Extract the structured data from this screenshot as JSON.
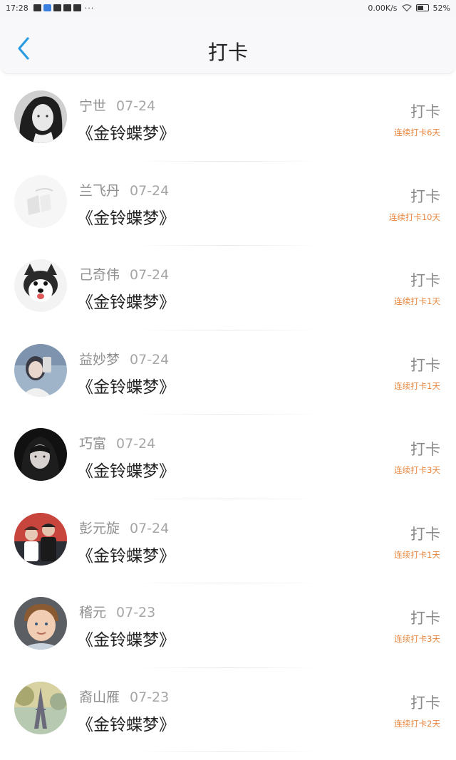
{
  "status_bar": {
    "time": "17:28",
    "more": "···",
    "speed": "0.00K/s",
    "battery": "52%"
  },
  "header": {
    "title": "打卡",
    "back_icon": "chevron-left-icon",
    "accent_color": "#2a9be0"
  },
  "entries": [
    {
      "name": "宁世",
      "date": "07-24",
      "book": "《金铃蝶梦》",
      "action": "打卡",
      "streak": "连续打卡6天",
      "avatar": "woman-dark-hair-bw"
    },
    {
      "name": "兰飞丹",
      "date": "07-24",
      "book": "《金铃蝶梦》",
      "action": "打卡",
      "streak": "连续打卡10天",
      "avatar": "white-abstract"
    },
    {
      "name": "己奇伟",
      "date": "07-24",
      "book": "《金铃蝶梦》",
      "action": "打卡",
      "streak": "连续打卡1天",
      "avatar": "husky-dog"
    },
    {
      "name": "益妙梦",
      "date": "07-24",
      "book": "《金铃蝶梦》",
      "action": "打卡",
      "streak": "连续打卡1天",
      "avatar": "selfie-girl"
    },
    {
      "name": "巧富",
      "date": "07-24",
      "book": "《金铃蝶梦》",
      "action": "打卡",
      "streak": "连续打卡3天",
      "avatar": "dark-portrait"
    },
    {
      "name": "彭元旋",
      "date": "07-24",
      "book": "《金铃蝶梦》",
      "action": "打卡",
      "streak": "连续打卡1天",
      "avatar": "couple-photo"
    },
    {
      "name": "稽元",
      "date": "07-23",
      "book": "《金铃蝶梦》",
      "action": "打卡",
      "streak": "连续打卡3天",
      "avatar": "boy-portrait"
    },
    {
      "name": "裔山雁",
      "date": "07-23",
      "book": "《金铃蝶梦》",
      "action": "打卡",
      "streak": "连续打卡2天",
      "avatar": "eiffel-tower"
    }
  ],
  "colors": {
    "streak": "#e8853c",
    "checkin": "#8a8a8a",
    "name": "#8f8f8f"
  }
}
